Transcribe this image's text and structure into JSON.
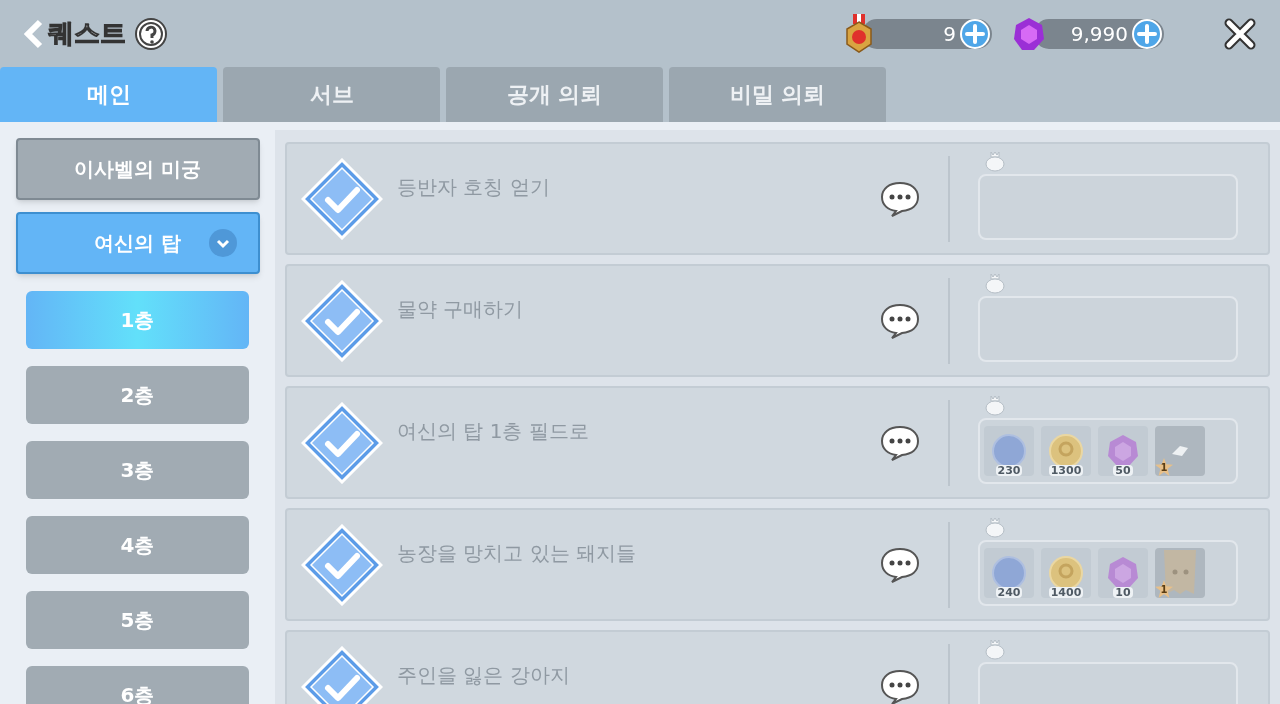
{
  "header": {
    "title": "퀘스트",
    "currencies": [
      {
        "kind": "medal",
        "amount": "9"
      },
      {
        "kind": "gem",
        "amount": "9,990"
      }
    ]
  },
  "tabs": [
    {
      "label": "메인",
      "selected": true
    },
    {
      "label": "서브",
      "selected": false
    },
    {
      "label": "공개 의뢰",
      "selected": false
    },
    {
      "label": "비밀 의뢰",
      "selected": false
    }
  ],
  "sidebar": {
    "groups": [
      {
        "label": "이사벨의 미궁",
        "expanded": false
      },
      {
        "label": "여신의 탑",
        "expanded": true,
        "children": [
          {
            "label": "1층",
            "selected": true
          },
          {
            "label": "2층",
            "selected": false
          },
          {
            "label": "3층",
            "selected": false
          },
          {
            "label": "4층",
            "selected": false
          },
          {
            "label": "5층",
            "selected": false
          },
          {
            "label": "6층",
            "selected": false
          }
        ]
      }
    ]
  },
  "quests": [
    {
      "title": "등반자 호칭 얻기",
      "completed": true
    },
    {
      "title": "물약 구매하기",
      "completed": true
    },
    {
      "title": "여신의 탑 1층 필드로",
      "completed": true,
      "rewards": [
        {
          "kind": "exp",
          "amount": "230"
        },
        {
          "kind": "gold",
          "amount": "1300"
        },
        {
          "kind": "gem",
          "amount": "50"
        },
        {
          "kind": "stone",
          "grade": "1"
        }
      ]
    },
    {
      "title": "농장을 망치고 있는 돼지들",
      "completed": true,
      "rewards": [
        {
          "kind": "exp",
          "amount": "240"
        },
        {
          "kind": "gold",
          "amount": "1400"
        },
        {
          "kind": "gem",
          "amount": "10"
        },
        {
          "kind": "sack",
          "grade": "1"
        }
      ]
    },
    {
      "title": "주인을 잃은 강아지",
      "completed": true
    }
  ]
}
